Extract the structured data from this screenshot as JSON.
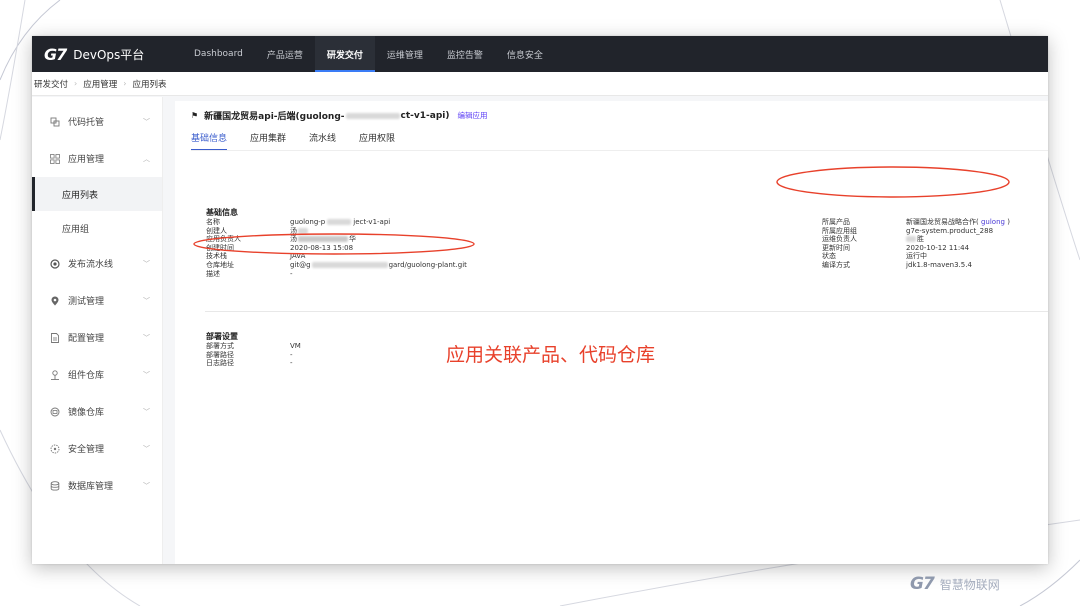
{
  "topnav": {
    "logo_mark": "G7",
    "logo_text": "DevOps平台",
    "items": [
      "Dashboard",
      "产品运营",
      "研发交付",
      "运维管理",
      "监控告警",
      "信息安全"
    ],
    "active_index": 2
  },
  "breadcrumb": [
    "研发交付",
    "应用管理",
    "应用列表"
  ],
  "sidebar": {
    "items": [
      {
        "label": "代码托管",
        "icon": "code-icon"
      },
      {
        "label": "应用管理",
        "icon": "grid-icon",
        "expanded": true,
        "children": [
          "应用列表",
          "应用组"
        ]
      },
      {
        "label": "发布流水线",
        "icon": "pipeline-icon"
      },
      {
        "label": "测试管理",
        "icon": "test-icon"
      },
      {
        "label": "配置管理",
        "icon": "config-icon"
      },
      {
        "label": "组件仓库",
        "icon": "component-icon"
      },
      {
        "label": "镜像仓库",
        "icon": "image-icon"
      },
      {
        "label": "安全管理",
        "icon": "security-icon"
      },
      {
        "label": "数据库管理",
        "icon": "database-icon"
      }
    ],
    "active_sub": "应用列表"
  },
  "main": {
    "title": "新疆国龙贸易api-后端(guolong-",
    "title_end": "ct-v1-api)",
    "edit_link": "编辑应用",
    "tabs": [
      "基础信息",
      "应用集群",
      "流水线",
      "应用权限"
    ],
    "active_tab": 0,
    "basic": {
      "section_title": "基础信息",
      "left": [
        {
          "k": "名称",
          "v": "guolong-p",
          "v2": "ject-v1-api"
        },
        {
          "k": "创建人",
          "v": "汤"
        },
        {
          "k": "应用负责人",
          "v": "汤",
          "v2": "华"
        },
        {
          "k": "创建时间",
          "v": "2020-08-13 15:08"
        },
        {
          "k": "技术栈",
          "v": "JAVA"
        },
        {
          "k": "仓库地址",
          "v": "git@g",
          "v2": "gard/guolong-plant.git"
        },
        {
          "k": "描述",
          "v": "-"
        }
      ],
      "right": [
        {
          "k": "所属产品",
          "v": "新疆国龙贸易战略合作(",
          "link": "gulong",
          "v_end": ")"
        },
        {
          "k": "所属应用组",
          "v": "g7e-system.product_288"
        },
        {
          "k": "运维负责人",
          "v": "",
          "v2": "胜"
        },
        {
          "k": "更新时间",
          "v": "2020-10-12 11:44"
        },
        {
          "k": "状态",
          "v": "运行中"
        },
        {
          "k": "编译方式",
          "v": "jdk1.8-maven3.5.4"
        }
      ]
    },
    "deploy": {
      "section_title": "部署设置",
      "rows": [
        {
          "k": "部署方式",
          "v": "VM"
        },
        {
          "k": "部署路径",
          "v": "-"
        },
        {
          "k": "日志路径",
          "v": "-"
        }
      ]
    }
  },
  "annotation": {
    "text": "应用关联产品、代码仓库",
    "color": "#e8412b"
  },
  "watermark": {
    "mark": "G7",
    "text": "智慧物联网"
  }
}
